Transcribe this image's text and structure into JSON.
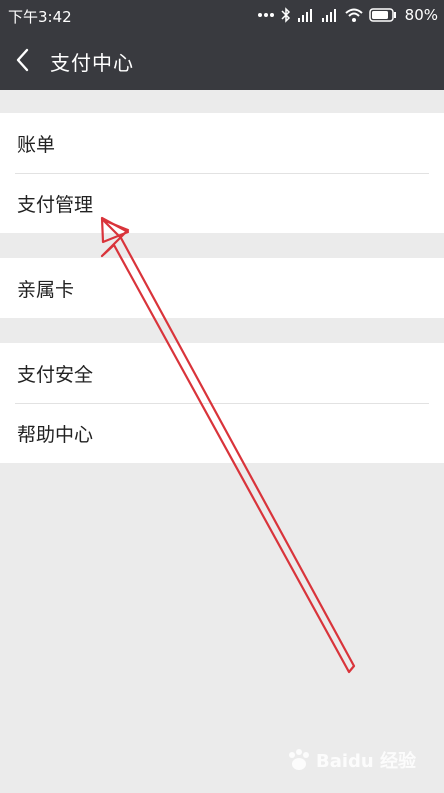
{
  "status_bar": {
    "time": "下午3:42",
    "battery": "80%"
  },
  "header": {
    "title": "支付中心",
    "back_icon": "chevron-left-icon"
  },
  "menu": {
    "group1": [
      "账单",
      "支付管理"
    ],
    "group2": [
      "亲属卡"
    ],
    "group3": [
      "支付安全",
      "帮助中心"
    ]
  },
  "annotation": {
    "color": "#d9343b"
  },
  "watermark": {
    "text": "Baidu 经验"
  }
}
